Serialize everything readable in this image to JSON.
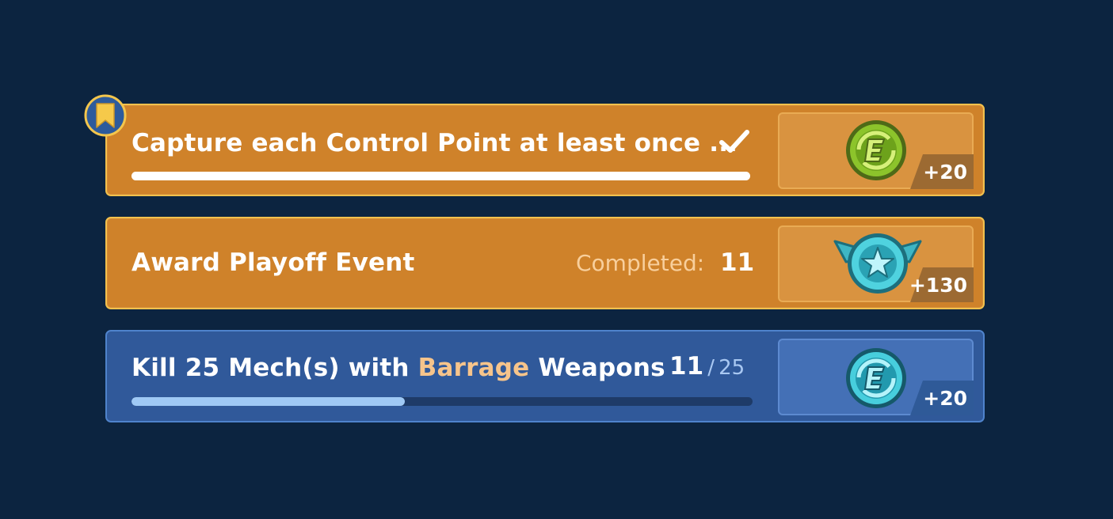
{
  "missions": [
    {
      "title": "Capture each Control Point at least once ...",
      "status": "done",
      "progress": 1.0,
      "reward": {
        "icon": "green-e-coin-icon",
        "amount": "+20"
      }
    },
    {
      "title": "Award Playoff Event",
      "completed_label": "Completed:",
      "completed_value": "11",
      "reward": {
        "icon": "star-wings-badge-icon",
        "amount": "+130"
      }
    },
    {
      "title_parts": [
        "Kill 25 Mech(s) with ",
        "Barrage",
        " Weapons"
      ],
      "current": "11",
      "separator": "/",
      "max": "25",
      "progress": 0.44,
      "reward": {
        "icon": "teal-e-coin-icon",
        "amount": "+20"
      }
    }
  ],
  "colors": {
    "background": "#0c2440",
    "orange_card": "#cf822a",
    "blue_card": "#30599a",
    "highlight_text": "#f6c48b",
    "progress_fill_blue": "#9fc9f5"
  }
}
